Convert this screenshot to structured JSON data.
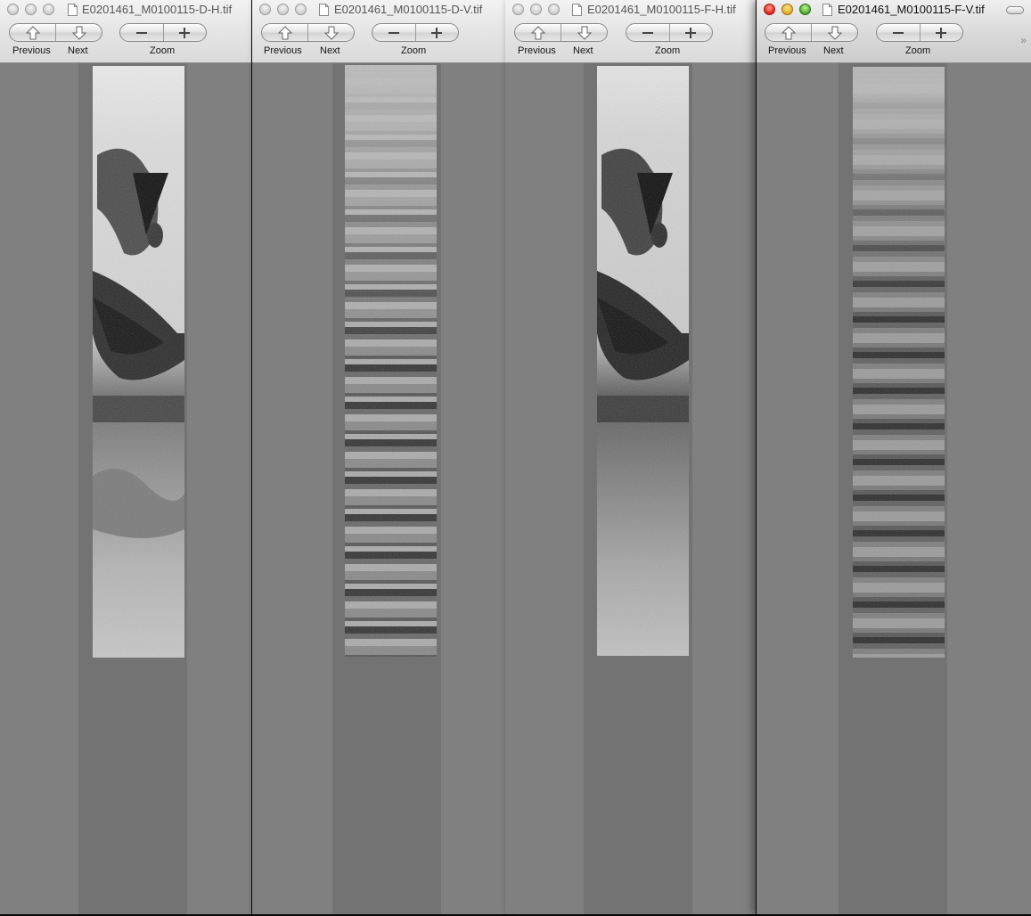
{
  "toolbar": {
    "previous_label": "Previous",
    "next_label": "Next",
    "zoom_label": "Zoom",
    "overflow": "»"
  },
  "windows": [
    {
      "title": "E0201461_M0100115-D-H.tif",
      "active": false
    },
    {
      "title": "E0201461_M0100115-D-V.tif",
      "active": false
    },
    {
      "title": "E0201461_M0100115-F-H.tif",
      "active": false
    },
    {
      "title": "E0201461_M0100115-F-V.tif",
      "active": true
    }
  ],
  "colors": {
    "close": "#e0231b",
    "minimize": "#e0a81b",
    "zoom": "#46a62a",
    "canvas_background": "#808080",
    "image_column": "#737373"
  },
  "icons": [
    "document-icon",
    "arrow-up-icon",
    "arrow-down-icon",
    "minus-icon",
    "plus-icon",
    "resize-pill-icon",
    "chevron-double-right-icon"
  ]
}
